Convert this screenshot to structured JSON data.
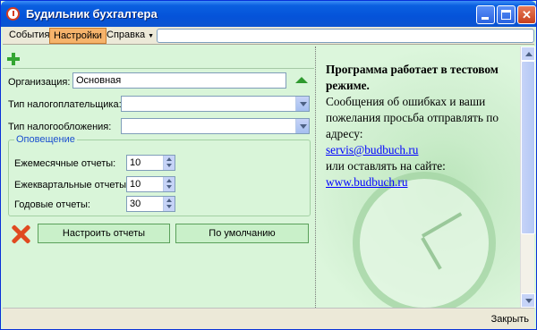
{
  "window": {
    "title": "Будильник бухгалтера"
  },
  "menu": {
    "events": "События",
    "settings": "Настройки",
    "help": "Справка",
    "help_arrow": "▼"
  },
  "form": {
    "organization_label": "Организация:",
    "organization_value": "Основная",
    "taxpayer_type_label": "Тип налогоплательщика:",
    "taxpayer_type_value": "",
    "taxation_type_label": "Тип налогообложения:",
    "taxation_type_value": ""
  },
  "notification": {
    "group_title": "Оповещение",
    "monthly_label": "Ежемесячные отчеты:",
    "monthly_value": "10",
    "quarterly_label": "Ежеквартальные отчеты:",
    "quarterly_value": "10",
    "yearly_label": "Годовые отчеты:",
    "yearly_value": "30"
  },
  "buttons": {
    "configure_reports": "Настроить отчеты",
    "defaults": "По умолчанию"
  },
  "info": {
    "line1_bold": "Программа работает в тестовом режиме.",
    "line2": "Сообщения об ошибках и ваши пожелания просьба отправлять по адресу:",
    "email": "servis@budbuch.ru",
    "line3": "или оставлять на сайте:",
    "site": "www.budbuch.ru"
  },
  "status": {
    "close": "Закрыть"
  },
  "colors": {
    "accent_menu": "#f6b36b",
    "panel_bg": "#d9f5d9",
    "link": "#0000ff",
    "title_bar": "#0553d9"
  }
}
